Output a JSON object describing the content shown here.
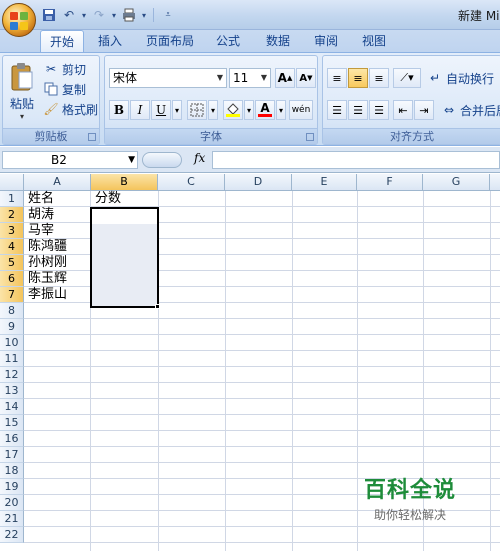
{
  "window": {
    "title": "新建 Mi"
  },
  "qat": {
    "save_icon": "save-icon",
    "undo_icon": "undo-icon",
    "redo_icon": "redo-icon",
    "print_icon": "print-icon"
  },
  "tabs": [
    {
      "label": "开始",
      "active": true
    },
    {
      "label": "插入"
    },
    {
      "label": "页面布局"
    },
    {
      "label": "公式"
    },
    {
      "label": "数据"
    },
    {
      "label": "审阅"
    },
    {
      "label": "视图"
    }
  ],
  "clipboard": {
    "paste": "粘贴",
    "cut": "剪切",
    "copy": "复制",
    "format_painter": "格式刷",
    "group": "剪贴板"
  },
  "font": {
    "name": "宋体",
    "size": "11",
    "group": "字体",
    "bold": "B",
    "italic": "I",
    "underline": "U",
    "grow": "A",
    "shrink": "A",
    "font_color": "A",
    "phonetic": "wén"
  },
  "alignment": {
    "wrap": "自动换行",
    "merge": "合并后居",
    "group": "对齐方式"
  },
  "formula_bar": {
    "name_box": "B2",
    "fx": "fx",
    "value": ""
  },
  "columns": [
    "A",
    "B",
    "C",
    "D",
    "E",
    "F",
    "G"
  ],
  "rows": [
    "1",
    "2",
    "3",
    "4",
    "5",
    "6",
    "7",
    "8",
    "9",
    "10",
    "11",
    "12",
    "13",
    "14",
    "15",
    "16",
    "17",
    "18",
    "19",
    "20",
    "21",
    "22"
  ],
  "selected_column": "B",
  "selected_rows": [
    "2",
    "3",
    "4",
    "5",
    "6",
    "7"
  ],
  "cells": {
    "A1": "姓名",
    "B1": "分数",
    "A2": "胡涛",
    "A3": "马宰",
    "A4": "陈鸿疆",
    "A5": "孙树刚",
    "A6": "陈玉辉",
    "A7": "李振山"
  },
  "watermark": {
    "title": "百科全说",
    "subtitle": "助你轻松解决"
  }
}
